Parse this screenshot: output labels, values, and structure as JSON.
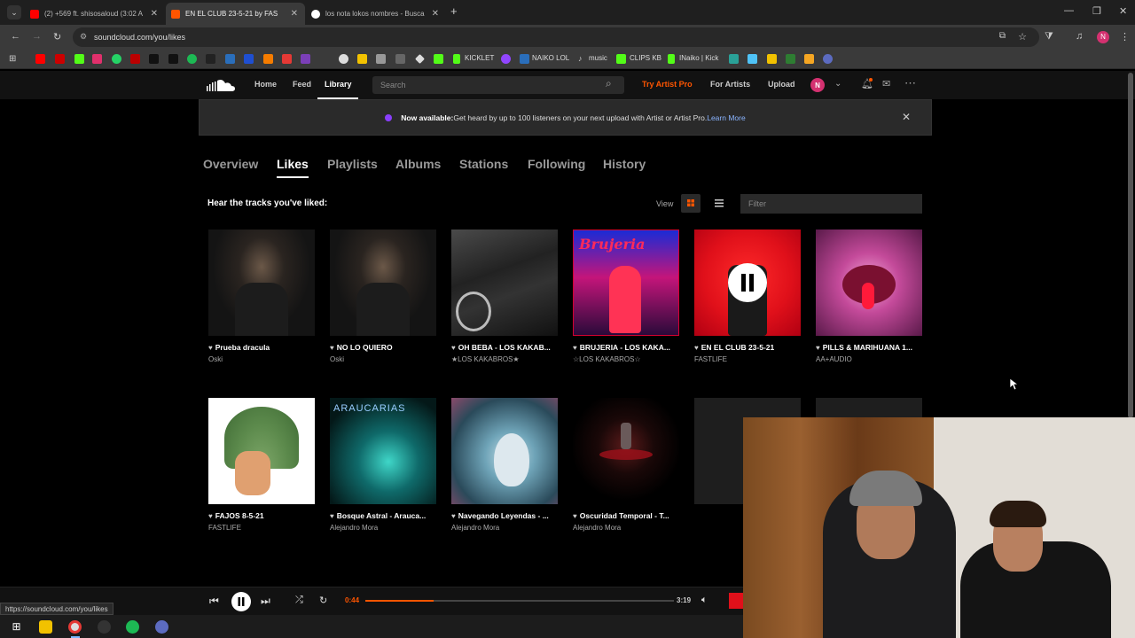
{
  "browser": {
    "tabs": [
      {
        "label": "(2) +569 ft. shisosaloud (3:02 A",
        "active": false
      },
      {
        "label": "EN EL CLUB 23-5-21 by FAS",
        "active": true
      },
      {
        "label": "los nota lokos nombres - Busca",
        "active": false
      }
    ],
    "url": "soundcloud.com/you/likes",
    "bookmarks": [
      "KICKLET",
      "NAIKO LOL",
      "music",
      "CLIPS KB",
      "INaiko | Kick"
    ]
  },
  "sc_header": {
    "home": "Home",
    "feed": "Feed",
    "library": "Library",
    "search_placeholder": "Search",
    "try_pro": "Try Artist Pro",
    "for_artists": "For Artists",
    "upload": "Upload",
    "avatar_initial": "N"
  },
  "banner": {
    "bold": "Now available:",
    "text": " Get heard by up to 100 listeners on your next upload with Artist or Artist Pro.",
    "link": " Learn More"
  },
  "subtabs": [
    "Overview",
    "Likes",
    "Playlists",
    "Albums",
    "Stations",
    "Following",
    "History"
  ],
  "likes": {
    "heading": "Hear the tracks you've liked:",
    "view_label": "View",
    "filter_placeholder": "Filter",
    "tracks": [
      {
        "title": "Prueba dracula",
        "artist": "Oski"
      },
      {
        "title": "NO LO QUIERO",
        "artist": "Oski"
      },
      {
        "title": "OH BEBA - LOS KAKAB...",
        "artist": "★LOS KAKABROS★"
      },
      {
        "title": "BRUJERIA - LOS KAKA...",
        "artist": "☆LOS KAKABROS☆"
      },
      {
        "title": "EN EL CLUB 23-5-21",
        "artist": "FASTLIFE"
      },
      {
        "title": "PILLS & MARIHUANA 1...",
        "artist": "AA+AUDIO"
      },
      {
        "title": "FAJOS 8-5-21",
        "artist": "FASTLIFE"
      },
      {
        "title": "Bosque Astral - Arauca...",
        "artist": "Alejandro Mora"
      },
      {
        "title": "Navegando Leyendas - ...",
        "artist": "Alejandro Mora"
      },
      {
        "title": "Oscuridad Temporal - T...",
        "artist": "Alejandro Mora"
      }
    ],
    "cover_text": {
      "brujeria": "Brujeria",
      "araucarias": "ARAUCARIAS"
    }
  },
  "player": {
    "elapsed": "0:44",
    "duration": "3:19",
    "progress": 0.22
  },
  "status_url": "https://soundcloud.com/you/likes",
  "colors": {
    "accent": "#ff5500",
    "pro": "#ff5500",
    "avatar": "#d43170"
  }
}
